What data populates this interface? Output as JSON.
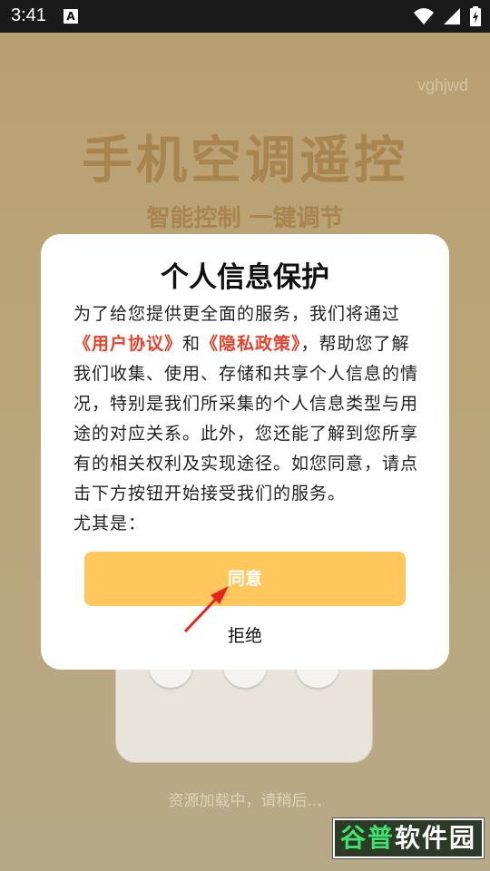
{
  "status_bar": {
    "time": "3:41",
    "notification_letter": "A"
  },
  "splash": {
    "watermark": "vghjwd",
    "title": "手机空调遥控",
    "subtitle": "智能控制 一键调节",
    "loading_text": "资源加载中，请稍后..."
  },
  "dialog": {
    "title": "个人信息保护",
    "body_part1": "为了给您提供更全面的服务，我们将通过",
    "link_user": "《用户协议》",
    "body_and": "和",
    "link_privacy": "《隐私政策》",
    "body_part2": "，帮助您了解我们收集、使用、存储和共享个人信息的情况，特别是我们所采集的个人信息类型与用途的对应关系。此外，您还能了解到您所享有的相关权利及实现途径。如您同意，请点击下方按钮开始接受我们的服务。",
    "body_cut_line": "尤其是：",
    "agree_label": "同意",
    "decline_label": "拒绝"
  },
  "site_logo": {
    "green_part": "谷普",
    "white_part": "软件园"
  },
  "colors": {
    "accent": "#ffc75c",
    "link": "#e7412a",
    "title_brown": "#a8844f"
  }
}
